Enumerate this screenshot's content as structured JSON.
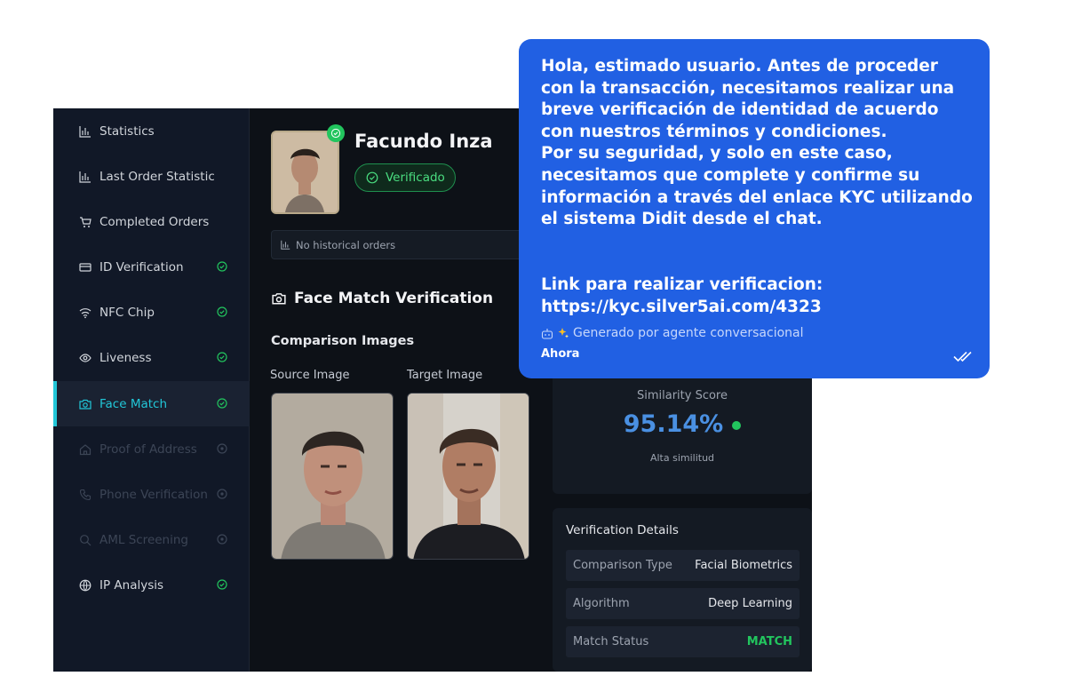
{
  "sidebar": {
    "items": [
      {
        "label": "Statistics",
        "icon": "bar-chart-icon",
        "status": "none"
      },
      {
        "label": "Last Order Statistic",
        "icon": "bar-chart-icon",
        "status": "none"
      },
      {
        "label": "Completed Orders",
        "icon": "cart-icon",
        "status": "none"
      },
      {
        "label": "ID Verification",
        "icon": "id-card-icon",
        "status": "verified"
      },
      {
        "label": "NFC Chip",
        "icon": "wifi-icon",
        "status": "verified"
      },
      {
        "label": "Liveness",
        "icon": "eye-icon",
        "status": "verified"
      },
      {
        "label": "Face Match",
        "icon": "camera-icon",
        "status": "verified",
        "active": true
      },
      {
        "label": "Proof of Address",
        "icon": "home-icon",
        "status": "disabled"
      },
      {
        "label": "Phone Verification",
        "icon": "phone-icon",
        "status": "disabled"
      },
      {
        "label": "AML Screening",
        "icon": "search-icon",
        "status": "disabled"
      },
      {
        "label": "IP Analysis",
        "icon": "globe-icon",
        "status": "verified"
      }
    ]
  },
  "profile": {
    "name": "Facundo Inza",
    "status_label": "Verificado",
    "history_text": "No historical orders"
  },
  "face_match": {
    "section_title": "Face Match Verification",
    "comparison_title": "Comparison Images",
    "source_label": "Source Image",
    "target_label": "Target Image"
  },
  "similarity": {
    "label": "Similarity Score",
    "value": "95.14%",
    "sublabel": "Alta similitud"
  },
  "details": {
    "title": "Verification Details",
    "rows": [
      {
        "key": "Comparison Type",
        "value": "Facial Biometrics"
      },
      {
        "key": "Algorithm",
        "value": "Deep Learning"
      },
      {
        "key": "Match Status",
        "value": "MATCH"
      }
    ]
  },
  "chat": {
    "lines": [
      "Hola, estimado usuario. Antes de proceder con la transacción, necesitamos realizar una breve verificación de identidad de acuerdo con nuestros términos y condiciones.",
      "Por su seguridad, y solo en este caso, necesitamos que complete y confirme su información a través del enlace KYC utilizando el sistema Didit desde el chat.",
      "",
      "",
      "Link para realizar verificacion: https://kyc.silver5ai.com/4323"
    ],
    "generated_label": "Generado por agente conversacional",
    "timestamp": "Ahora"
  },
  "colors": {
    "accent": "#22c7d8",
    "success": "#22c55e",
    "chat_bg": "#2160e3",
    "score": "#4a90e2"
  }
}
